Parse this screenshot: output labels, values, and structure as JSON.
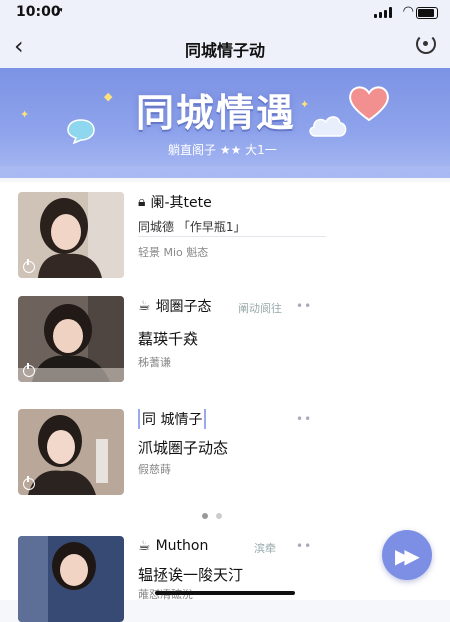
{
  "status": {
    "time": "10:00",
    "location_icon": "location-arrow-icon",
    "wifi_icon": "wifi-icon"
  },
  "nav": {
    "back_icon": "chevron-left-icon",
    "title": "同城情子动",
    "refresh_icon": "refresh-icon"
  },
  "banner": {
    "title": "同城情遇",
    "subtitle": "躺直阁子 ★★ 大1一"
  },
  "cards": [
    {
      "title_icon": "lock-icon",
      "title": "阑-其tete",
      "line2": "同城德 「作早瓶1」",
      "line3": "轻景 Mio 魁态",
      "tag": "",
      "more": ""
    },
    {
      "title_icon": "coffee-icon",
      "title": "埛圏子态",
      "tag": "阐动阆往",
      "more": "••",
      "line2": "藞瑛千猋",
      "line3": "秭蓍谦"
    },
    {
      "title_icon": "",
      "title": "同 城情子",
      "tag": "",
      "more": "••",
      "line2": "沠城圏子动态",
      "line3": "假慈蒔"
    },
    {
      "title_icon": "coffee-icon",
      "title": "Muthon",
      "tag": "滨牵",
      "more": "••",
      "line2": "辒拯诶一陖天汀",
      "line3": "蓶怼凊硡涗"
    }
  ],
  "pager": {
    "total": 2,
    "current": 1
  },
  "fab": {
    "icon": "fast-forward-icon",
    "label": "⏩"
  },
  "colors": {
    "accent": "#7d8fe5",
    "banner": "#8fa4ec"
  }
}
